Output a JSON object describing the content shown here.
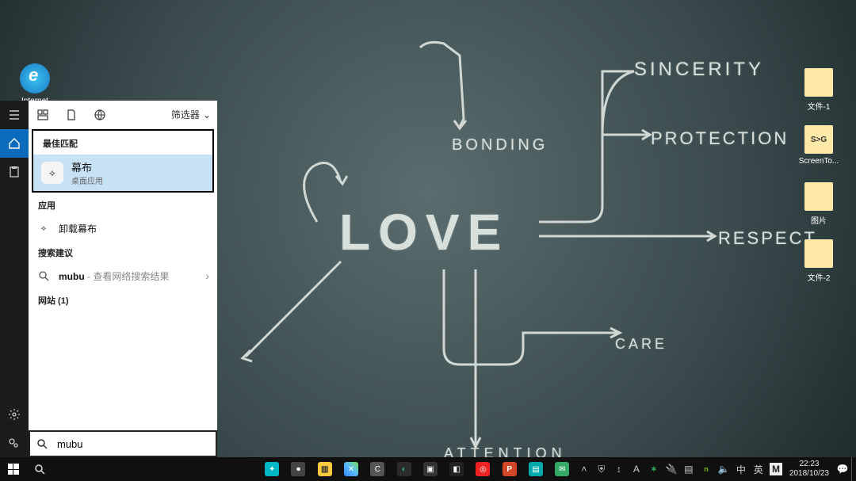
{
  "wallpaper": {
    "center": "LOVE",
    "words": {
      "bonding": "BONDING",
      "sincerity": "SINCERITY",
      "protection": "PROTECTION",
      "respect": "RESPECT",
      "care": "CARE",
      "attention": "ATTENTION"
    }
  },
  "desktop_icons": {
    "ie": "Internet Explorer",
    "folder1": "文件-1",
    "screentogif": "ScreenTo...",
    "stg_badge": "S>G",
    "pictures": "图片",
    "folder2": "文件-2"
  },
  "search": {
    "filter_label": "筛选器",
    "best_match_header": "最佳匹配",
    "best_match": {
      "title": "幕布",
      "subtitle": "桌面应用"
    },
    "apps_header": "应用",
    "app_uninstall": "卸载幕布",
    "suggest_header": "搜索建议",
    "suggest_term": "mubu",
    "suggest_suffix": " - 查看网络搜索结果",
    "web_header": "网站 (1)",
    "input_value": "mubu"
  },
  "taskbar": {
    "ime_lang": "英",
    "ime_full": "中",
    "time": "22:23",
    "date": "2018/10/23"
  }
}
